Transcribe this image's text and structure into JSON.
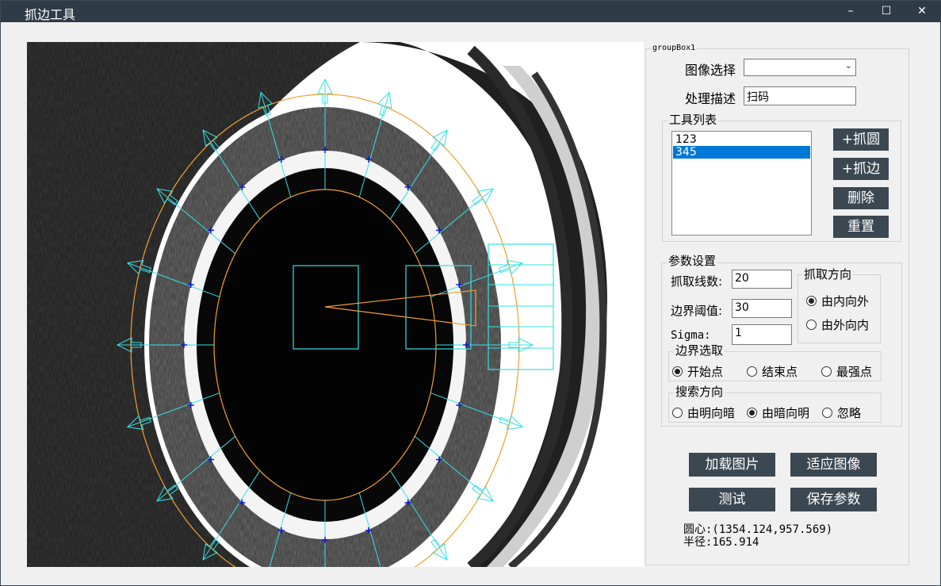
{
  "window": {
    "title": "抓边工具",
    "minimize": "–",
    "maximize": "☐",
    "close": "✕"
  },
  "groupbox": {
    "title": "groupBox1"
  },
  "image_select": {
    "label": "图像选择",
    "value": ""
  },
  "process_desc": {
    "label": "处理描述",
    "value": "扫码"
  },
  "tool_list": {
    "title": "工具列表",
    "items": [
      "123",
      "345"
    ],
    "selected_index": 1,
    "buttons": {
      "add_circle": "+抓圆",
      "add_edge": "+抓边",
      "delete": "删除",
      "reset": "重置"
    }
  },
  "params": {
    "title": "参数设置",
    "line_count_label": "抓取线数:",
    "line_count_value": "20",
    "threshold_label": "边界阈值:",
    "threshold_value": "30",
    "sigma_label": "Sigma:",
    "sigma_value": "1"
  },
  "grab_direction": {
    "title": "抓取方向",
    "options": [
      "由内向外",
      "由外向内"
    ],
    "selected": "由内向外"
  },
  "edge_select": {
    "title": "边界选取",
    "options": [
      "开始点",
      "结束点",
      "最强点"
    ],
    "selected": "开始点"
  },
  "search_direction": {
    "title": "搜索方向",
    "options": [
      "由明向暗",
      "由暗向明",
      "忽略"
    ],
    "selected": "由暗向明"
  },
  "actions": {
    "load_image": "加载图片",
    "fit_image": "适应图像",
    "test": "测试",
    "save_params": "保存参数"
  },
  "result": {
    "center": "圆心:(1354.124,957.569)",
    "radius": "半径:165.914"
  },
  "colors": {
    "titlebar": "#2f3b47",
    "button": "#3b4852",
    "selection": "#0078d7",
    "overlay_cyan": "#35e0e6",
    "overlay_orange": "#f0a030",
    "edge_point": "#1515c0"
  }
}
